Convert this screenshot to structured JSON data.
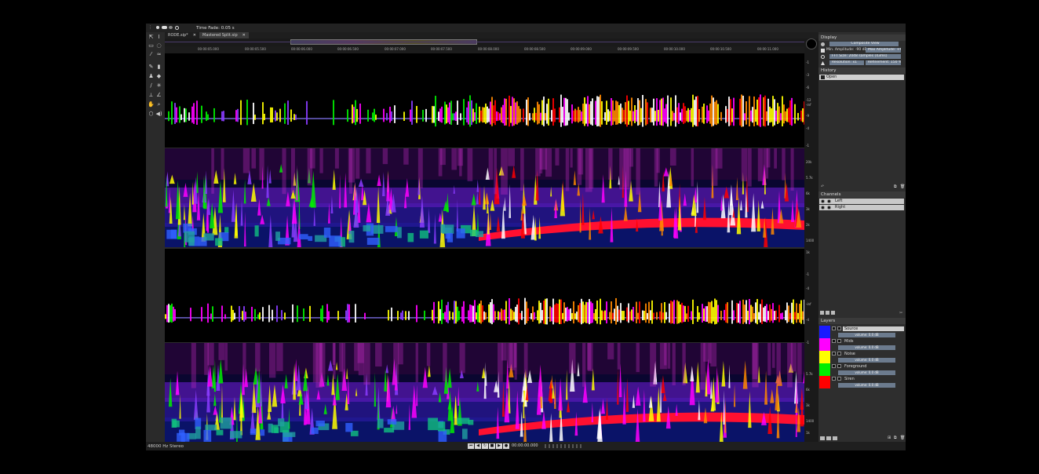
{
  "topbar": {
    "time_fade": "Time Fade: 0.05 s"
  },
  "tabs": [
    {
      "label": "RODE.sip*",
      "active": false
    },
    {
      "label": "Mastered Split.sip",
      "active": true
    }
  ],
  "ruler": {
    "ticks": [
      "00:00:05.000",
      "00:00:05.500",
      "00:00:06.000",
      "00:00:06.500",
      "00:00:07.000",
      "00:00:07.500",
      "00:00:08.000",
      "00:00:08.500",
      "00:00:09.000",
      "00:00:09.500",
      "00:00:10.000",
      "00:00:10.500",
      "00:00:11.000"
    ]
  },
  "scales": {
    "waveform": [
      "-1",
      "-2",
      "-3",
      "-4",
      "-6",
      "-9",
      "-12",
      "-inf",
      "-12",
      "-9",
      "-6",
      "-4",
      "-3",
      "-2",
      "-1"
    ],
    "spectro": [
      "20k",
      "5.7k",
      "6k",
      "3k",
      "2k",
      "1400",
      "1k",
      "Hz"
    ]
  },
  "display": {
    "title": "Display",
    "view": "Composite View",
    "min_amp_label": "Min. Amplitude: -90 dB",
    "max_amp_label": "Max Amplitude: +6 dB",
    "fft_label": "FFT Size: 2048 samples (43ms)",
    "resolution_label": "Resolution: x1",
    "refinement_label": "Refinement: 150 %"
  },
  "history": {
    "title": "History",
    "items": [
      "Open"
    ]
  },
  "channels": {
    "title": "Channels",
    "items": [
      "Left",
      "Right"
    ]
  },
  "layers": {
    "title": "Layers",
    "items": [
      {
        "name": "Source",
        "volume": "volume: 0.0 dB",
        "color": "#1a1aff"
      },
      {
        "name": "Mids",
        "volume": "volume: 0.0 dB",
        "color": "#ff00ff"
      },
      {
        "name": "Noise",
        "volume": "volume: 0.0 dB",
        "color": "#ffff00"
      },
      {
        "name": "Foreground",
        "volume": "volume: 0.0 dB",
        "color": "#00ee00"
      },
      {
        "name": "Siren",
        "volume": "volume: 0.0 dB",
        "color": "#ff0000"
      }
    ]
  },
  "status": {
    "format": "48000 Hz Stereo",
    "timecode": "00:00:00.000"
  },
  "colors": {
    "source": "#1a1aff",
    "mids": "#ff00ff",
    "noise": "#ffff00",
    "foreground": "#00ee00",
    "siren": "#ff0000"
  }
}
